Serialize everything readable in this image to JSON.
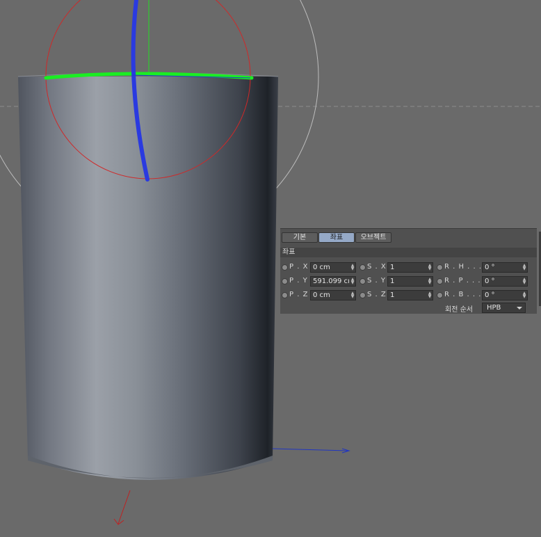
{
  "panel": {
    "tabs": [
      {
        "label": "기본",
        "active": false
      },
      {
        "label": "좌표",
        "active": true
      },
      {
        "label": "오브젝트",
        "active": false
      }
    ],
    "section_title": "좌표",
    "rows": [
      [
        {
          "label": "P . X",
          "value": "0 cm"
        },
        {
          "label": "S . X",
          "value": "1"
        },
        {
          "label": "R . H . . . .",
          "value": "0 °"
        }
      ],
      [
        {
          "label": "P . Y",
          "value": "591.099 cı"
        },
        {
          "label": "S . Y",
          "value": "1"
        },
        {
          "label": "R . P . . . .",
          "value": "0 °"
        }
      ],
      [
        {
          "label": "P . Z",
          "value": "0 cm"
        },
        {
          "label": "S . Z",
          "value": "1"
        },
        {
          "label": "R . B . . . .",
          "value": "0 °"
        }
      ]
    ],
    "rotation_order_label": "회전 순서",
    "rotation_order_value": "HPB"
  },
  "colors": {
    "background": "#6a6a6a",
    "axis_x": "#2040c0",
    "axis_y": "#1aee22",
    "axis_z": "#c02020",
    "active_tab": "#95a9c7"
  }
}
